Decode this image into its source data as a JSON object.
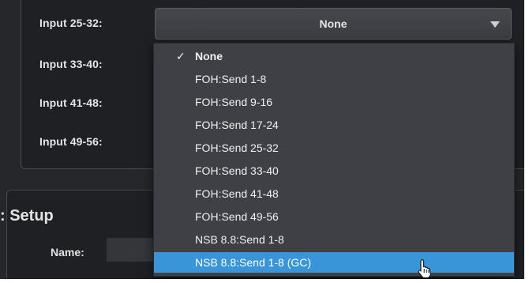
{
  "inputs": [
    {
      "label": "Input 25-32:"
    },
    {
      "label": "Input 33-40:"
    },
    {
      "label": "Input 41-48:"
    },
    {
      "label": "Input 49-56:"
    }
  ],
  "select": {
    "value": "None",
    "icon": "chevron-down-icon"
  },
  "dropdown": {
    "check_glyph": "✓",
    "selected_index": 0,
    "hovered_index": 10,
    "options": [
      {
        "label": "None"
      },
      {
        "label": "FOH:Send 1-8"
      },
      {
        "label": "FOH:Send 9-16"
      },
      {
        "label": "FOH:Send 17-24"
      },
      {
        "label": "FOH:Send 25-32"
      },
      {
        "label": "FOH:Send 33-40"
      },
      {
        "label": "FOH:Send 41-48"
      },
      {
        "label": "FOH:Send 49-56"
      },
      {
        "label": "NSB 8.8:Send 1-8"
      },
      {
        "label": "NSB 8.8:Send 1-8 (GC)"
      }
    ]
  },
  "setup": {
    "title": ": Setup",
    "name_label": "Name:",
    "name_value": ""
  },
  "colors": {
    "background": "#26272a",
    "panel": "#1f2023",
    "menu": "#3e4045",
    "highlight": "#3a95d8",
    "text": "#e4e4e4"
  }
}
